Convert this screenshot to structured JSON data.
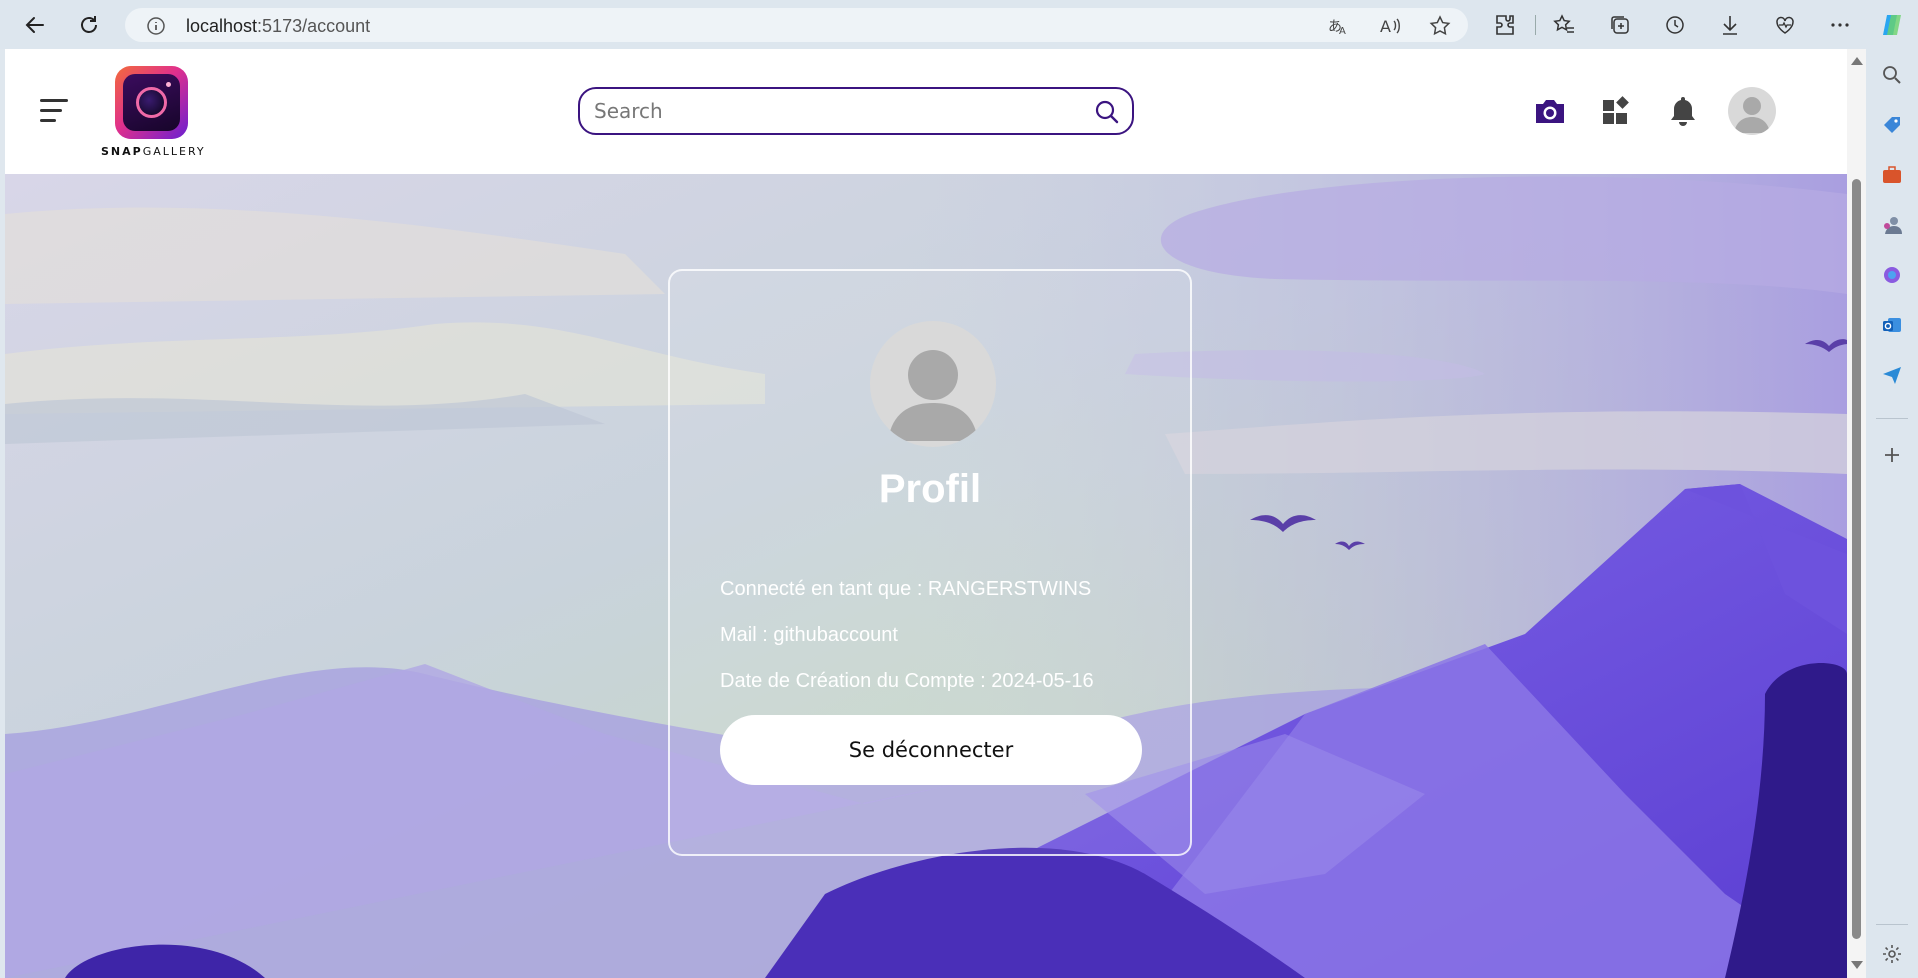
{
  "browser": {
    "url_host": "localhost",
    "url_rest": ":5173/account"
  },
  "app": {
    "logo_text_bold": "SNAP",
    "logo_text_light": "GALLERY",
    "search_placeholder": "Search"
  },
  "profile": {
    "title": "Profil",
    "connected_as": "Connecté en tant que : RANGERSTWINS",
    "mail": "Mail : githubaccount",
    "created": "Date de Création du Compte : 2024-05-16",
    "logout_label": "Se déconnecter"
  },
  "colors": {
    "brand_purple": "#3b1480",
    "mountain_dark": "#5a3fd0",
    "mountain_light": "#a79be3"
  }
}
